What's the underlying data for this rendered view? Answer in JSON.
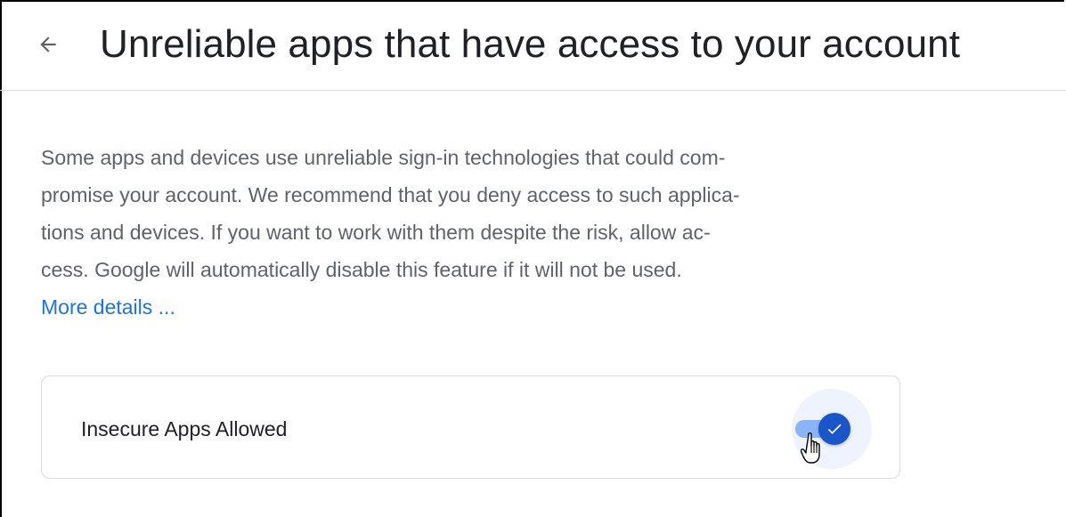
{
  "header": {
    "back_icon": "arrow-back-icon",
    "title": "Unreliable apps that have access to your account"
  },
  "description": {
    "lines": [
      "Some apps and devices use unreliable sign-in technologies that could com-",
      "promise your account. We recommend that you deny access to such applica-",
      "tions and devices. If you want to work with them despite the risk, allow ac-",
      "cess. Google will automatically disable this feature if it will not be used."
    ],
    "link_text": "More details ..."
  },
  "setting": {
    "label": "Insecure Apps Allowed",
    "toggle_state": "on",
    "toggle_icon": "check-icon"
  },
  "colors": {
    "accent": "#1a73e8",
    "toggle_knob": "#1a56c8",
    "toggle_track": "#8ab4f8",
    "text_primary": "#202124",
    "text_secondary": "#5f6368",
    "divider": "#dadce0"
  }
}
